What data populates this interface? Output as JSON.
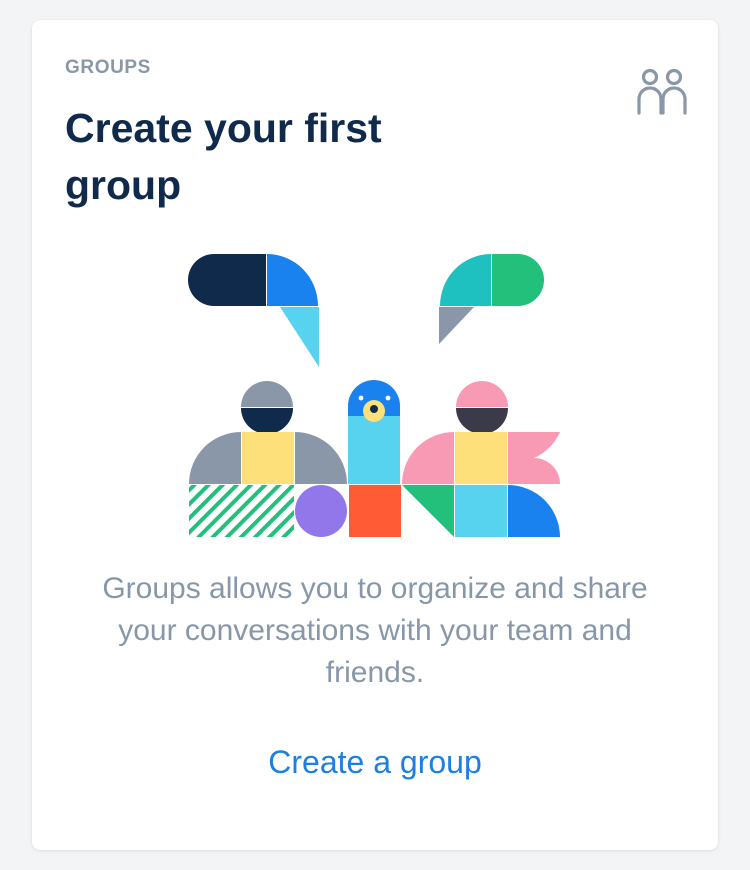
{
  "card": {
    "eyebrow": "GROUPS",
    "title": "Create your first group",
    "description": "Groups allows you to organize and share your conversations with your team and friends.",
    "cta_label": "Create a group",
    "header_icon": "people-icon",
    "illustration": "groups-illustration"
  },
  "colors": {
    "title": "#0f2a4a",
    "eyebrow": "#8a97a8",
    "description": "#8797a9",
    "link": "#1d7fe0",
    "background": "#f3f4f6",
    "card": "#ffffff"
  }
}
